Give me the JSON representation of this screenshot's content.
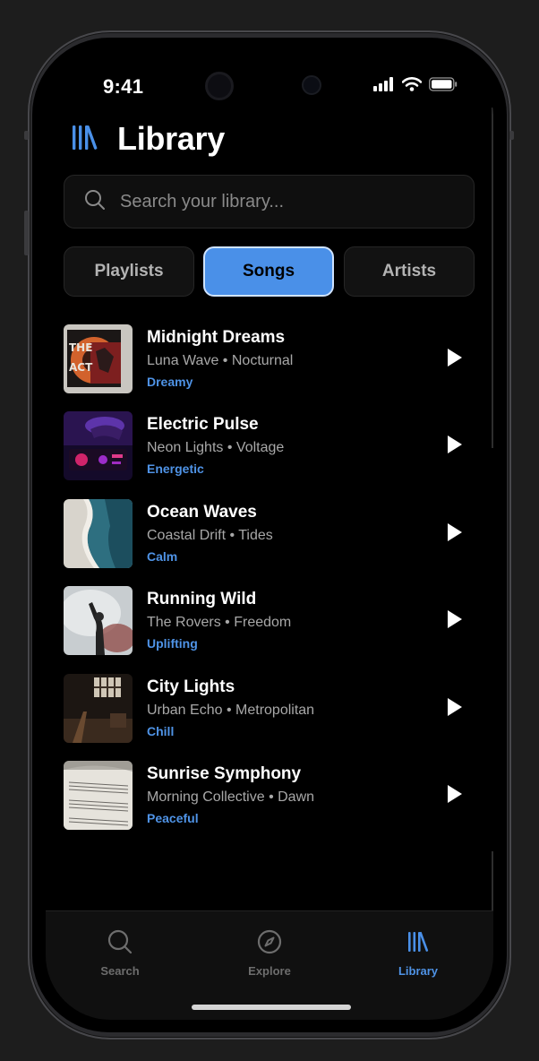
{
  "status_bar": {
    "time": "9:41",
    "icons": [
      "cellular-signal-icon",
      "wifi-icon",
      "battery-icon"
    ]
  },
  "header": {
    "icon": "library-icon",
    "title": "Library"
  },
  "search": {
    "placeholder": "Search your library...",
    "icon": "search-icon"
  },
  "tabs": [
    {
      "label": "Playlists",
      "active": false
    },
    {
      "label": "Songs",
      "active": true
    },
    {
      "label": "Artists",
      "active": false
    }
  ],
  "songs": [
    {
      "title": "Midnight Dreams",
      "artist": "Luna Wave",
      "album": "Nocturnal",
      "mood": "Dreamy"
    },
    {
      "title": "Electric Pulse",
      "artist": "Neon Lights",
      "album": "Voltage",
      "mood": "Energetic"
    },
    {
      "title": "Ocean Waves",
      "artist": "Coastal Drift",
      "album": "Tides",
      "mood": "Calm"
    },
    {
      "title": "Running Wild",
      "artist": "The Rovers",
      "album": "Freedom",
      "mood": "Uplifting"
    },
    {
      "title": "City Lights",
      "artist": "Urban Echo",
      "album": "Metropolitan",
      "mood": "Chill"
    },
    {
      "title": "Sunrise Symphony",
      "artist": "Morning Collective",
      "album": "Dawn",
      "mood": "Peaceful"
    }
  ],
  "separator": "•",
  "tab_bar": [
    {
      "label": "Search",
      "icon": "search-icon",
      "active": false
    },
    {
      "label": "Explore",
      "icon": "compass-icon",
      "active": false
    },
    {
      "label": "Library",
      "icon": "library-icon",
      "active": true
    }
  ],
  "colors": {
    "accent": "#4a90e8",
    "mood_text": "#4f93e6",
    "background": "#000000"
  }
}
